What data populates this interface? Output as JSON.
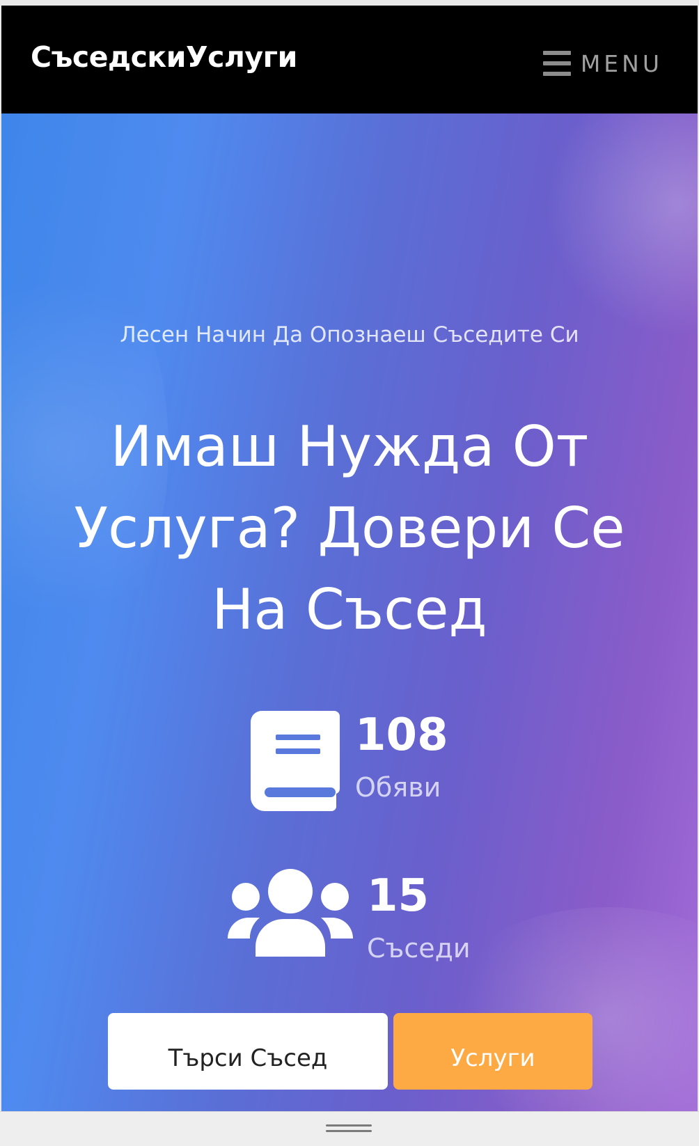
{
  "navbar": {
    "brand": "СъседскиУслуги",
    "menu_label": "MENU",
    "menu_icon": "hamburger-icon"
  },
  "hero": {
    "tagline": "Лесен Начин Да Опознаеш Съседите Си",
    "headline_line1": "Имаш Нужда От",
    "headline_line2": "Услуга? Довери Се",
    "headline_line3": "На Съсед",
    "stats": [
      {
        "icon": "book-icon",
        "value": "108",
        "label": "Обяви"
      },
      {
        "icon": "users-icon",
        "value": "15",
        "label": "Съседи"
      }
    ],
    "buttons": {
      "search": "Търси Съсед",
      "services": "Услуги"
    }
  },
  "colors": {
    "navbar_bg": "#000000",
    "gradient_start": "#3f86ea",
    "gradient_end": "#a26cd8",
    "services_button": "#fdaa45"
  }
}
